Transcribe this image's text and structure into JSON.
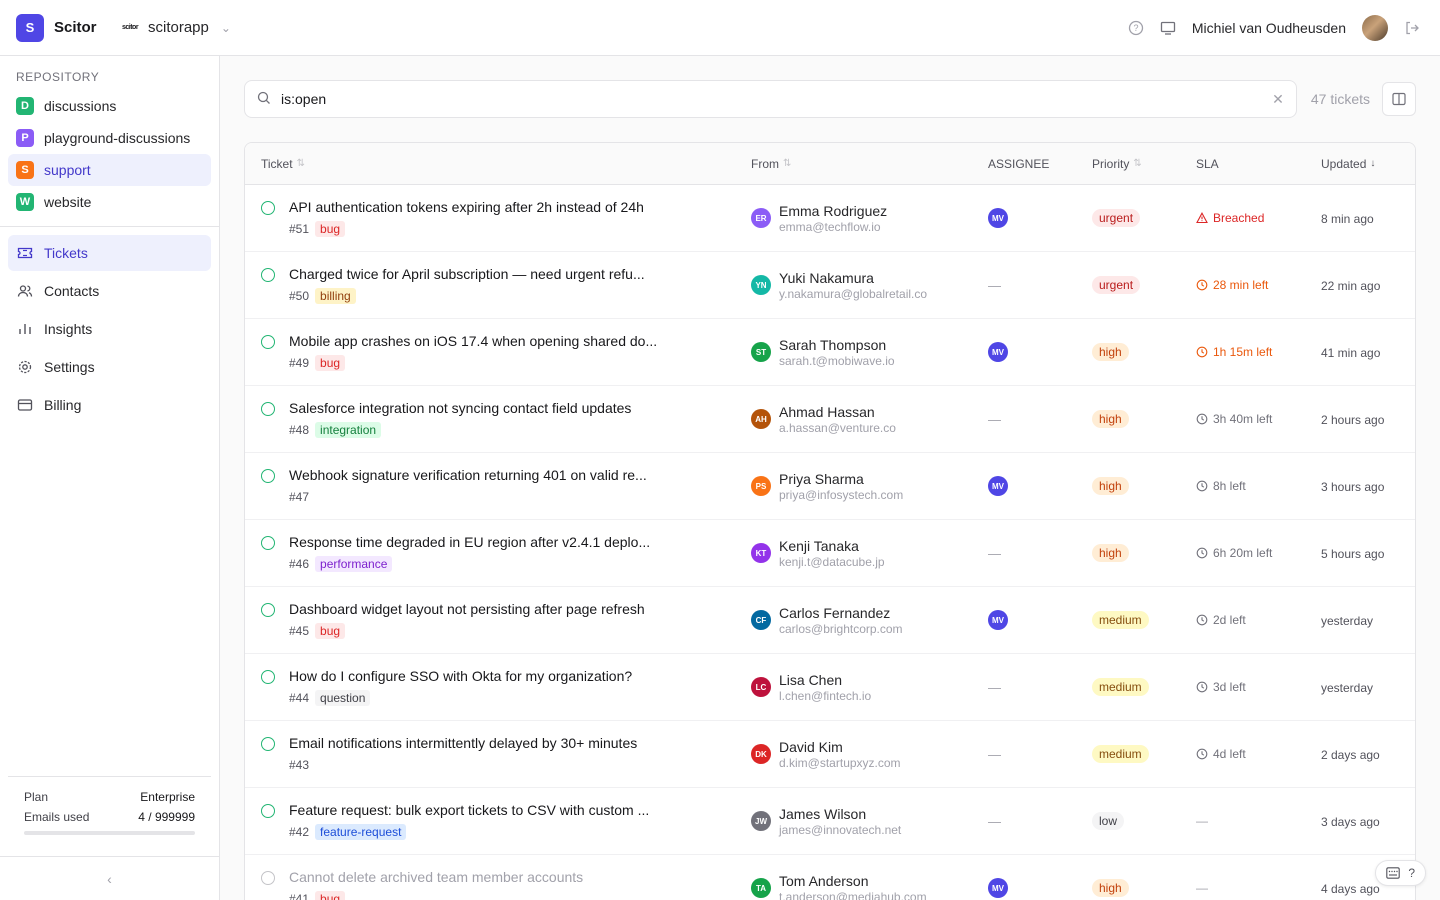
{
  "brand": {
    "logo_letter": "S",
    "name": "Scitor",
    "color": "#4f46e5"
  },
  "org": {
    "logo_text": "scitor",
    "name": "scitorapp"
  },
  "user": {
    "name": "Michiel van Oudheusden"
  },
  "sidebar": {
    "repository_title": "REPOSITORY",
    "repos": [
      {
        "letter": "D",
        "label": "discussions",
        "color": "#22b573",
        "active": false
      },
      {
        "letter": "P",
        "label": "playground-discussions",
        "color": "#8b5cf6",
        "active": false
      },
      {
        "letter": "S",
        "label": "support",
        "color": "#f97316",
        "active": true
      },
      {
        "letter": "W",
        "label": "website",
        "color": "#22b573",
        "active": false
      }
    ],
    "nav": [
      {
        "label": "Tickets",
        "icon": "ticket-icon",
        "glyph": "▭",
        "active": true
      },
      {
        "label": "Contacts",
        "icon": "contacts-icon",
        "glyph": "👥",
        "active": false
      },
      {
        "label": "Insights",
        "icon": "insights-icon",
        "glyph": "ılı",
        "active": false
      },
      {
        "label": "Settings",
        "icon": "gear-icon",
        "glyph": "⚙",
        "active": false
      },
      {
        "label": "Billing",
        "icon": "card-icon",
        "glyph": "▤",
        "active": false
      }
    ],
    "plan": {
      "plan_label": "Plan",
      "plan_value": "Enterprise",
      "emails_label": "Emails used",
      "emails_value": "4 / 999999"
    }
  },
  "search": {
    "value": "is:open",
    "count": "47 tickets"
  },
  "table": {
    "headers": {
      "ticket": "Ticket",
      "from": "From",
      "assignee": "ASSIGNEE",
      "priority": "Priority",
      "sla": "SLA",
      "updated": "Updated"
    },
    "rows": [
      {
        "title": "API authentication tokens expiring after 2h instead of 24h",
        "num": "#51",
        "tag": "bug",
        "from_initials": "ER",
        "from_color": "#8b5cf6",
        "from_name": "Emma Rodriguez",
        "from_email": "emma@techflow.io",
        "assignee": "MV",
        "priority": "urgent",
        "sla": "Breached",
        "sla_kind": "breached",
        "updated": "8 min ago",
        "closed": false
      },
      {
        "title": "Charged twice for April subscription — need urgent refu...",
        "num": "#50",
        "tag": "billing",
        "from_initials": "YN",
        "from_color": "#14b8a6",
        "from_name": "Yuki Nakamura",
        "from_email": "y.nakamura@globalretail.co",
        "assignee": "",
        "priority": "urgent",
        "sla": "28 min left",
        "sla_kind": "warn",
        "updated": "22 min ago",
        "closed": false
      },
      {
        "title": "Mobile app crashes on iOS 17.4 when opening shared do...",
        "num": "#49",
        "tag": "bug",
        "from_initials": "ST",
        "from_color": "#16a34a",
        "from_name": "Sarah Thompson",
        "from_email": "sarah.t@mobiwave.io",
        "assignee": "MV",
        "priority": "high",
        "sla": "1h 15m left",
        "sla_kind": "warn",
        "updated": "41 min ago",
        "closed": false
      },
      {
        "title": "Salesforce integration not syncing contact field updates",
        "num": "#48",
        "tag": "integration",
        "from_initials": "AH",
        "from_color": "#b45309",
        "from_name": "Ahmad Hassan",
        "from_email": "a.hassan@venture.co",
        "assignee": "",
        "priority": "high",
        "sla": "3h 40m left",
        "sla_kind": "normal",
        "updated": "2 hours ago",
        "closed": false
      },
      {
        "title": "Webhook signature verification returning 401 on valid re...",
        "num": "#47",
        "tag": "",
        "from_initials": "PS",
        "from_color": "#f97316",
        "from_name": "Priya Sharma",
        "from_email": "priya@infosystech.com",
        "assignee": "MV",
        "priority": "high",
        "sla": "8h left",
        "sla_kind": "normal",
        "updated": "3 hours ago",
        "closed": false
      },
      {
        "title": "Response time degraded in EU region after v2.4.1 deplo...",
        "num": "#46",
        "tag": "performance",
        "from_initials": "KT",
        "from_color": "#9333ea",
        "from_name": "Kenji Tanaka",
        "from_email": "kenji.t@datacube.jp",
        "assignee": "",
        "priority": "high",
        "sla": "6h 20m left",
        "sla_kind": "normal",
        "updated": "5 hours ago",
        "closed": false
      },
      {
        "title": "Dashboard widget layout not persisting after page refresh",
        "num": "#45",
        "tag": "bug",
        "from_initials": "CF",
        "from_color": "#0369a1",
        "from_name": "Carlos Fernandez",
        "from_email": "carlos@brightcorp.com",
        "assignee": "MV",
        "priority": "medium",
        "sla": "2d left",
        "sla_kind": "normal",
        "updated": "yesterday",
        "closed": false
      },
      {
        "title": "How do I configure SSO with Okta for my organization?",
        "num": "#44",
        "tag": "question",
        "from_initials": "LC",
        "from_color": "#be123c",
        "from_name": "Lisa Chen",
        "from_email": "l.chen@fintech.io",
        "assignee": "",
        "priority": "medium",
        "sla": "3d left",
        "sla_kind": "normal",
        "updated": "yesterday",
        "closed": false
      },
      {
        "title": "Email notifications intermittently delayed by 30+ minutes",
        "num": "#43",
        "tag": "",
        "from_initials": "DK",
        "from_color": "#dc2626",
        "from_name": "David Kim",
        "from_email": "d.kim@startupxyz.com",
        "assignee": "",
        "priority": "medium",
        "sla": "4d left",
        "sla_kind": "normal",
        "updated": "2 days ago",
        "closed": false
      },
      {
        "title": "Feature request: bulk export tickets to CSV with custom ...",
        "num": "#42",
        "tag": "feature-request",
        "from_initials": "JW",
        "from_color": "#71717a",
        "from_name": "James Wilson",
        "from_email": "james@innovatech.net",
        "assignee": "",
        "priority": "low",
        "sla": "—",
        "sla_kind": "none",
        "updated": "3 days ago",
        "closed": false
      },
      {
        "title": "Cannot delete archived team member accounts",
        "num": "#41",
        "tag": "bug",
        "from_initials": "TA",
        "from_color": "#16a34a",
        "from_name": "Tom Anderson",
        "from_email": "t.anderson@mediahub.com",
        "assignee": "MV",
        "priority": "high",
        "sla": "—",
        "sla_kind": "none",
        "updated": "4 days ago",
        "closed": true
      }
    ]
  },
  "help": {
    "label": "?"
  }
}
